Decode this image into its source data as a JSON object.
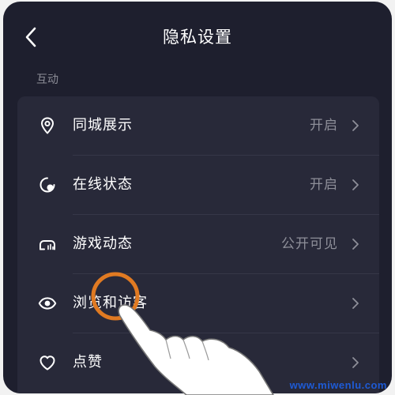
{
  "header": {
    "title": "隐私设置",
    "back_icon": "chevron-left-icon"
  },
  "section": {
    "label": "互动"
  },
  "rows": [
    {
      "label": "同城展示",
      "value": "开启",
      "icon": "location-pin-icon"
    },
    {
      "label": "在线状态",
      "value": "开启",
      "icon": "online-status-icon"
    },
    {
      "label": "游戏动态",
      "value": "公开可见",
      "icon": "gamepad-icon"
    },
    {
      "label": "浏览和访客",
      "value": "",
      "icon": "eye-icon"
    },
    {
      "label": "点赞",
      "value": "",
      "icon": "heart-icon"
    }
  ],
  "overlay": {
    "tap_indicator_color": "#e07a22",
    "hand_icon": "pointing-hand-icon"
  },
  "watermark": "www.miwenlu.com",
  "colors": {
    "background": "#1e1f2e",
    "card": "#282939",
    "text_primary": "#ffffff",
    "text_secondary": "#8e8f99",
    "watermark": "#1e5bd6"
  }
}
